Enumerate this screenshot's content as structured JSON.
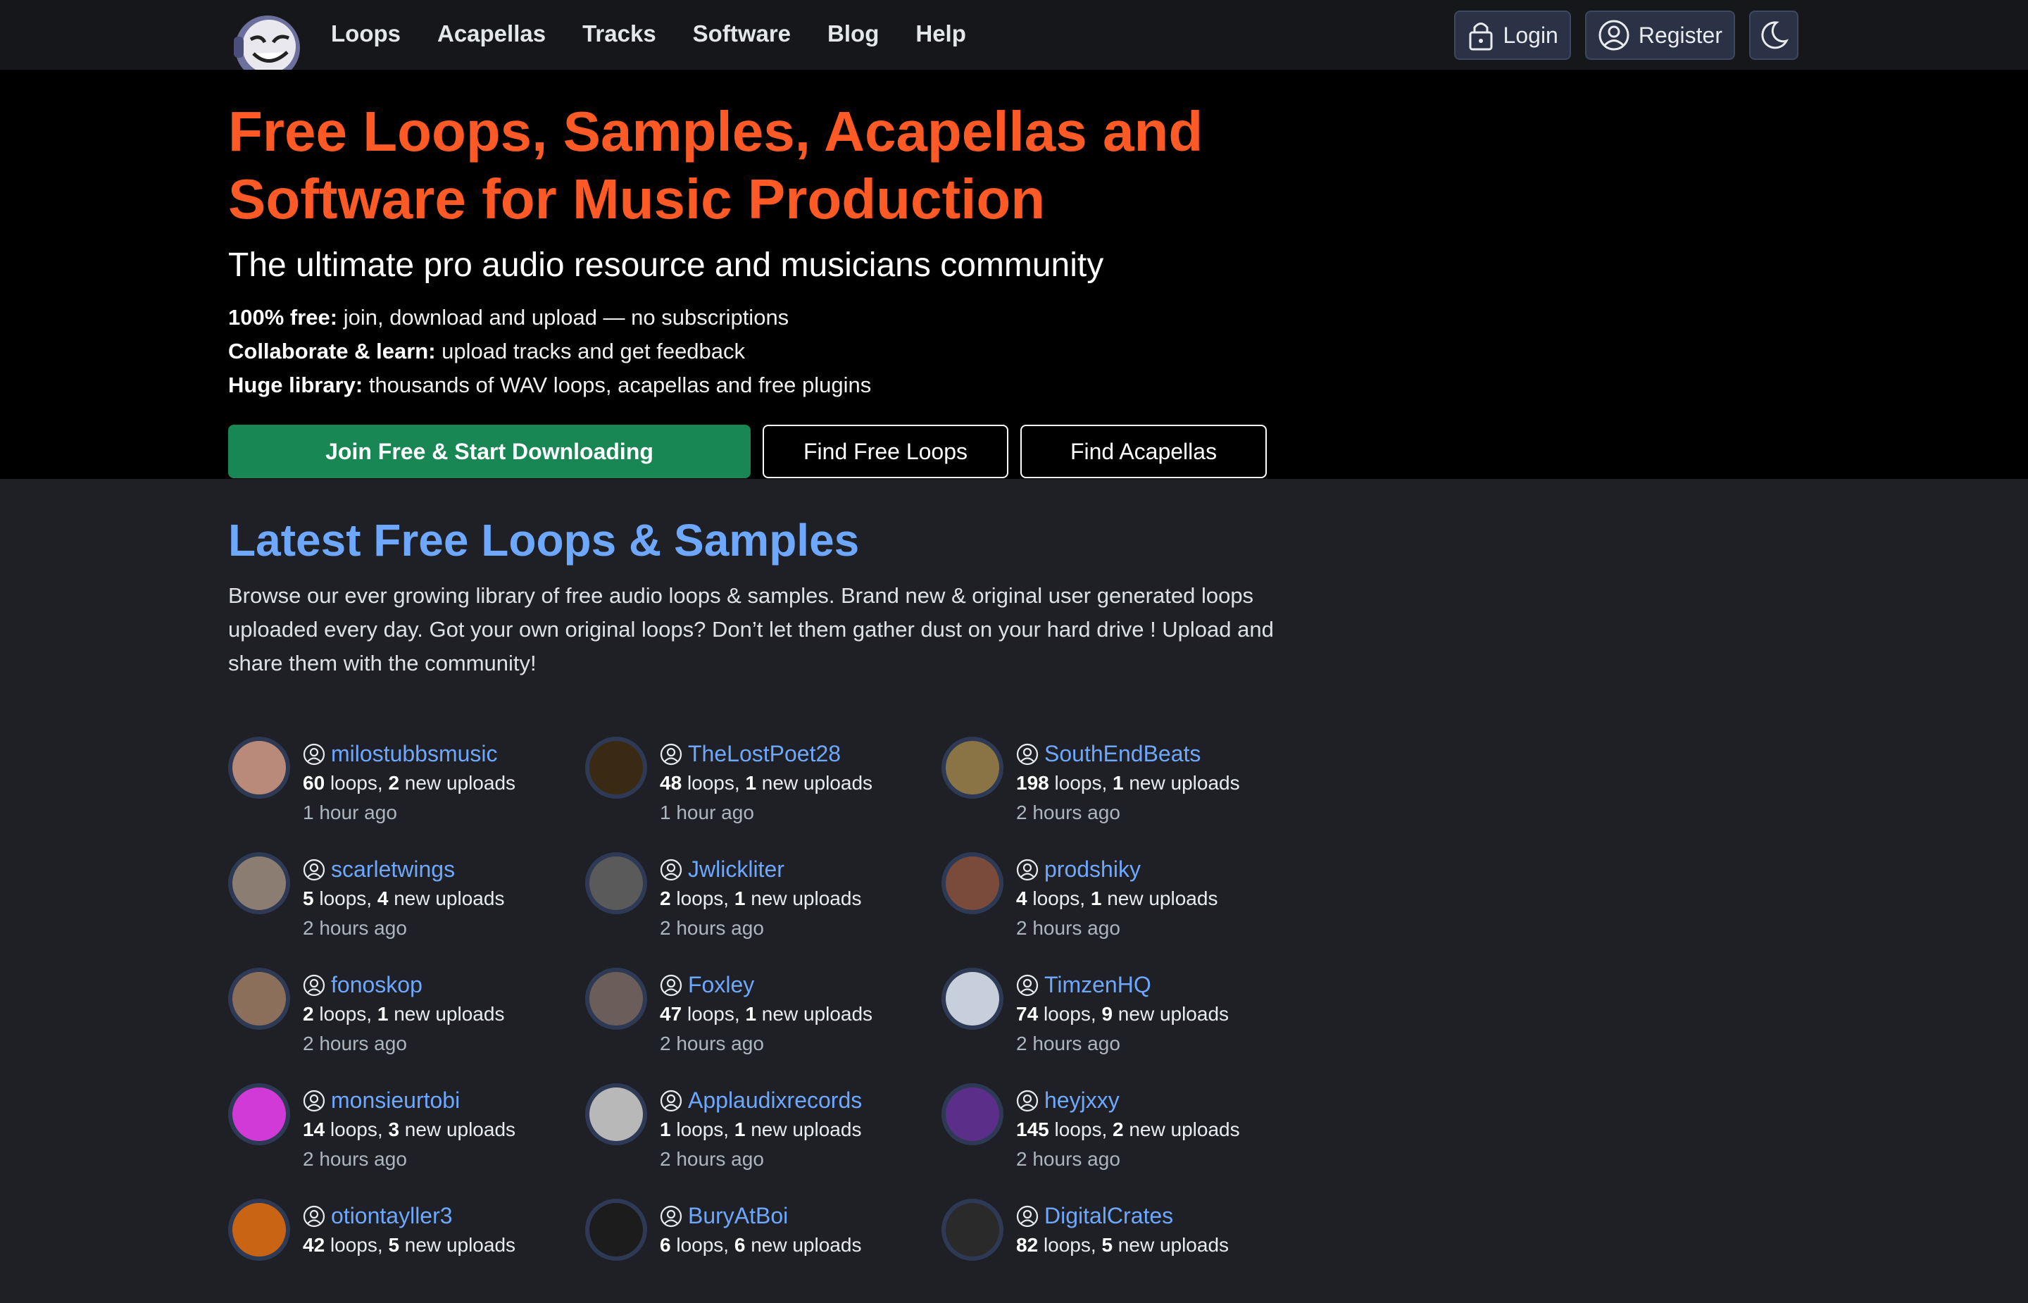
{
  "nav": {
    "links": [
      "Loops",
      "Acapellas",
      "Tracks",
      "Software",
      "Blog",
      "Help"
    ],
    "login": "Login",
    "register": "Register"
  },
  "hero": {
    "title": "Free Loops, Samples, Acapellas and Software for Music Production",
    "subtitle": "The ultimate pro audio resource and musicians community",
    "points": [
      {
        "bold": "100% free:",
        "text": " join, download and upload — no subscriptions"
      },
      {
        "bold": "Collaborate & learn:",
        "text": " upload tracks and get feedback"
      },
      {
        "bold": "Huge library:",
        "text": " thousands of WAV loops, acapellas and free plugins"
      }
    ],
    "cta_primary": "Join Free & Start Downloading",
    "cta_loops": "Find Free Loops",
    "cta_acapellas": "Find Acapellas"
  },
  "latest": {
    "title": "Latest Free Loops & Samples",
    "description": "Browse our ever growing library of free audio loops & samples. Brand new & original user generated loops uploaded every day. Got your own original loops? Don’t let them gather dust on your hard drive ! Upload and share them with the community!",
    "loops_word": "loops",
    "uploads_word": "new uploads",
    "users": [
      {
        "name": "milostubbsmusic",
        "loops": "60",
        "uploads": "2",
        "time": "1 hour ago",
        "color": "#b9897a"
      },
      {
        "name": "TheLostPoet28",
        "loops": "48",
        "uploads": "1",
        "time": "1 hour ago",
        "color": "#3a2a14"
      },
      {
        "name": "SouthEndBeats",
        "loops": "198",
        "uploads": "1",
        "time": "2 hours ago",
        "color": "#8a7445"
      },
      {
        "name": "scarletwings",
        "loops": "5",
        "uploads": "4",
        "time": "2 hours ago",
        "color": "#8c7d72"
      },
      {
        "name": "Jwlickliter",
        "loops": "2",
        "uploads": "1",
        "time": "2 hours ago",
        "color": "#5a5a5a"
      },
      {
        "name": "prodshiky",
        "loops": "4",
        "uploads": "1",
        "time": "2 hours ago",
        "color": "#7a4a3a"
      },
      {
        "name": "fonoskop",
        "loops": "2",
        "uploads": "1",
        "time": "2 hours ago",
        "color": "#8b6f5a"
      },
      {
        "name": "Foxley",
        "loops": "47",
        "uploads": "1",
        "time": "2 hours ago",
        "color": "#6b5e5a"
      },
      {
        "name": "TimzenHQ",
        "loops": "74",
        "uploads": "9",
        "time": "2 hours ago",
        "color": "#c7cfdc"
      },
      {
        "name": "monsieurtobi",
        "loops": "14",
        "uploads": "3",
        "time": "2 hours ago",
        "color": "#d13ad7"
      },
      {
        "name": "Applaudixrecords",
        "loops": "1",
        "uploads": "1",
        "time": "2 hours ago",
        "color": "#b8b8b8"
      },
      {
        "name": "heyjxxy",
        "loops": "145",
        "uploads": "2",
        "time": "2 hours ago",
        "color": "#5b2e8a"
      },
      {
        "name": "otiontayller3",
        "loops": "42",
        "uploads": "5",
        "time": "",
        "color": "#c96414"
      },
      {
        "name": "BuryAtBoi",
        "loops": "6",
        "uploads": "6",
        "time": "",
        "color": "#1c1c1c"
      },
      {
        "name": "DigitalCrates",
        "loops": "82",
        "uploads": "5",
        "time": "",
        "color": "#2a2a2a"
      }
    ]
  }
}
